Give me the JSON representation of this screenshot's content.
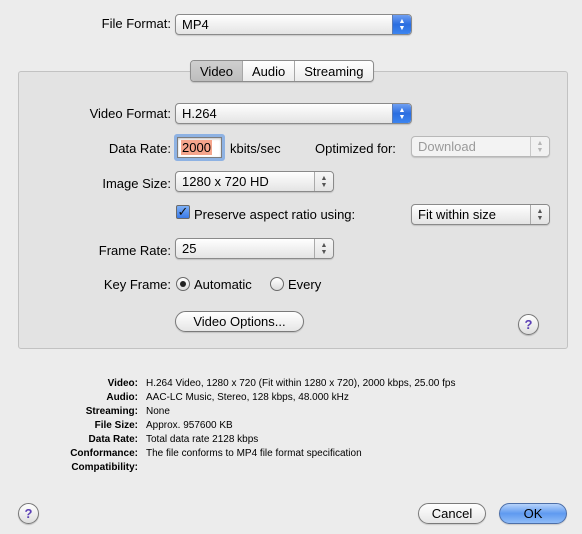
{
  "file_format": {
    "label": "File Format:",
    "value": "MP4"
  },
  "tabs": [
    {
      "label": "Video",
      "selected": true
    },
    {
      "label": "Audio",
      "selected": false
    },
    {
      "label": "Streaming",
      "selected": false
    }
  ],
  "video": {
    "format_label": "Video Format:",
    "format_value": "H.264",
    "data_rate_label": "Data Rate:",
    "data_rate_value": "2000",
    "data_rate_unit": "kbits/sec",
    "optimized_label": "Optimized for:",
    "optimized_value": "Download",
    "image_size_label": "Image Size:",
    "image_size_value": "1280 x 720 HD",
    "preserve_label": "Preserve aspect ratio using:",
    "preserve_checked": true,
    "fit_value": "Fit within size",
    "frame_rate_label": "Frame Rate:",
    "frame_rate_value": "25",
    "key_frame_label": "Key Frame:",
    "key_auto": "Automatic",
    "key_every": "Every",
    "options_button": "Video Options..."
  },
  "summary": [
    {
      "key": "Video:",
      "value": "H.264 Video, 1280 x 720 (Fit within 1280 x 720), 2000 kbps, 25.00 fps"
    },
    {
      "key": "Audio:",
      "value": "AAC-LC Music, Stereo, 128 kbps, 48.000 kHz"
    },
    {
      "key": "Streaming:",
      "value": "None"
    },
    {
      "key": "File Size:",
      "value": "Approx. 957600 KB"
    },
    {
      "key": "Data Rate:",
      "value": "Total data rate 2128 kbps"
    },
    {
      "key": "Conformance:",
      "value": "The file conforms to MP4 file format specification"
    },
    {
      "key": "Compatibility:",
      "value": ""
    }
  ],
  "buttons": {
    "help": "?",
    "cancel": "Cancel",
    "ok": "OK"
  },
  "colors": {
    "accent": "#3d85f0",
    "highlight": "#f5a58c",
    "help_glyph": "#5b3fb5"
  }
}
